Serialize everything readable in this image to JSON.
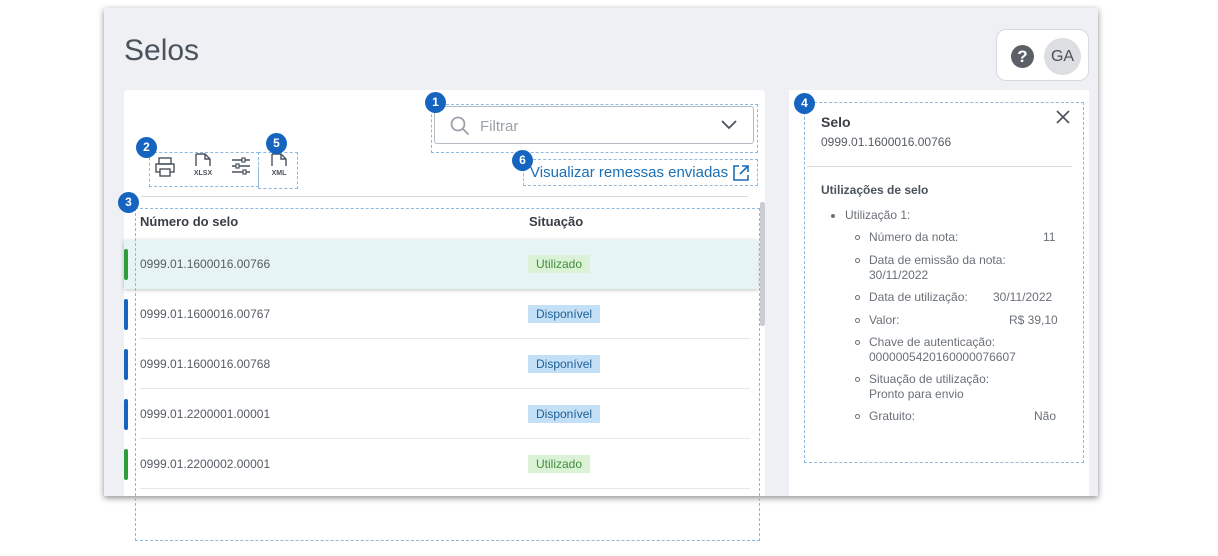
{
  "page": {
    "title": "Selos"
  },
  "header": {
    "help_icon": "question-circle-icon",
    "avatar_initials": "GA"
  },
  "filter": {
    "placeholder": "Filtrar"
  },
  "toolbar": {
    "buttons": [
      {
        "icon": "printer-icon"
      },
      {
        "icon": "xlsx-file-icon",
        "label": "XLSX"
      },
      {
        "icon": "sliders-icon"
      },
      {
        "icon": "xml-file-icon",
        "label": "XML"
      }
    ]
  },
  "links": {
    "remessas": "Visualizar remessas enviadas",
    "remessas_icon": "external-link-icon"
  },
  "table": {
    "columns": [
      "Número do selo",
      "Situação"
    ],
    "rows": [
      {
        "numero": "0999.01.1600016.00766",
        "situacao": "Utilizado",
        "status_color": "#2e9e3a",
        "selected": true
      },
      {
        "numero": "0999.01.1600016.00767",
        "situacao": "Disponível",
        "status_color": "#1565c0",
        "selected": false
      },
      {
        "numero": "0999.01.1600016.00768",
        "situacao": "Disponível",
        "status_color": "#1565c0",
        "selected": false
      },
      {
        "numero": "0999.01.2200001.00001",
        "situacao": "Disponível",
        "status_color": "#1565c0",
        "selected": false
      },
      {
        "numero": "0999.01.2200002.00001",
        "situacao": "Utilizado",
        "status_color": "#2e9e3a",
        "selected": false
      }
    ]
  },
  "detail": {
    "title": "Selo",
    "subtitle": "0999.01.1600016.00766",
    "section_title": "Utilizações de selo",
    "item_label": "Utilização 1:",
    "fields": {
      "numero_nota_label": "Número da nota:",
      "numero_nota_value": "11",
      "data_emissao_label": "Data de emissão da nota:",
      "data_emissao_value": "30/11/2022",
      "data_utilizacao_label": "Data de utilização:",
      "data_utilizacao_value": "30/11/2022",
      "valor_label": "Valor:",
      "valor_value": "R$ 39,10",
      "chave_label": "Chave de autenticação:",
      "chave_value": "0000005420160000076607",
      "situacao_label": "Situação de utilização:",
      "situacao_value": "Pronto para envio",
      "gratuito_label": "Gratuito:",
      "gratuito_value": "Não"
    }
  },
  "annotations": [
    "1",
    "2",
    "3",
    "4",
    "5",
    "6"
  ],
  "colors": {
    "accent": "#1565c0",
    "link": "#1a6fb5",
    "utilizado_bg": "#dcf2d6",
    "utilizado_text": "#3d8f3d",
    "disponivel_bg": "#c3e0f7",
    "disponivel_text": "#1f5f96"
  }
}
